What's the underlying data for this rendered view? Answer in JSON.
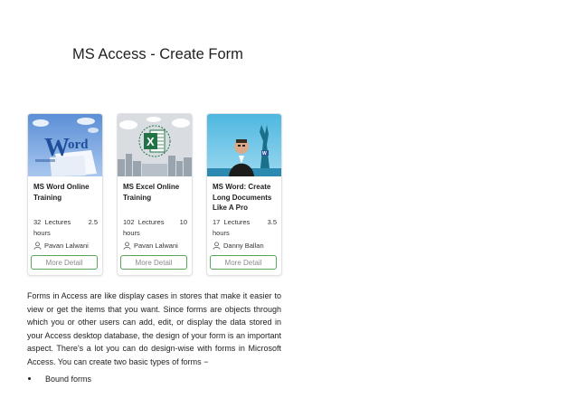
{
  "page": {
    "title": "MS Access - Create Form"
  },
  "courses": [
    {
      "title": "MS Word Online Training",
      "lectures": "32",
      "lectures_label": "Lectures",
      "hours": "2.5",
      "hours_label": "hours",
      "author": "Pavan Lalwani",
      "button": "More Detail",
      "thumb_icon": "word-logo-icon"
    },
    {
      "title": "MS Excel Online Training",
      "lectures": "102",
      "lectures_label": "Lectures",
      "hours": "10",
      "hours_label": "hours",
      "author": "Pavan Lalwani",
      "button": "More Detail",
      "thumb_icon": "excel-logo-icon"
    },
    {
      "title": "MS Word: Create Long Documents Like A Pro",
      "lectures": "17",
      "lectures_label": "Lectures",
      "hours": "3.5",
      "hours_label": "hours",
      "author": "Danny Ballan",
      "button": "More Detail",
      "thumb_icon": "instructor-photo"
    }
  ],
  "article": {
    "paragraph": "Forms in Access are like display cases in stores that make it easier to view or get the items that you want. Since forms are objects through which you or other users can add, edit, or display the data stored in your Access desktop database, the design of your form is an important aspect. There's a lot you can do design-wise with forms in Microsoft Access. You can create two basic types of forms −",
    "bullets": [
      "Bound forms"
    ]
  },
  "colors": {
    "button_border": "#5aa55a",
    "button_text": "#8a8a8a",
    "word_blue": "#2b579a",
    "excel_green": "#217346"
  }
}
